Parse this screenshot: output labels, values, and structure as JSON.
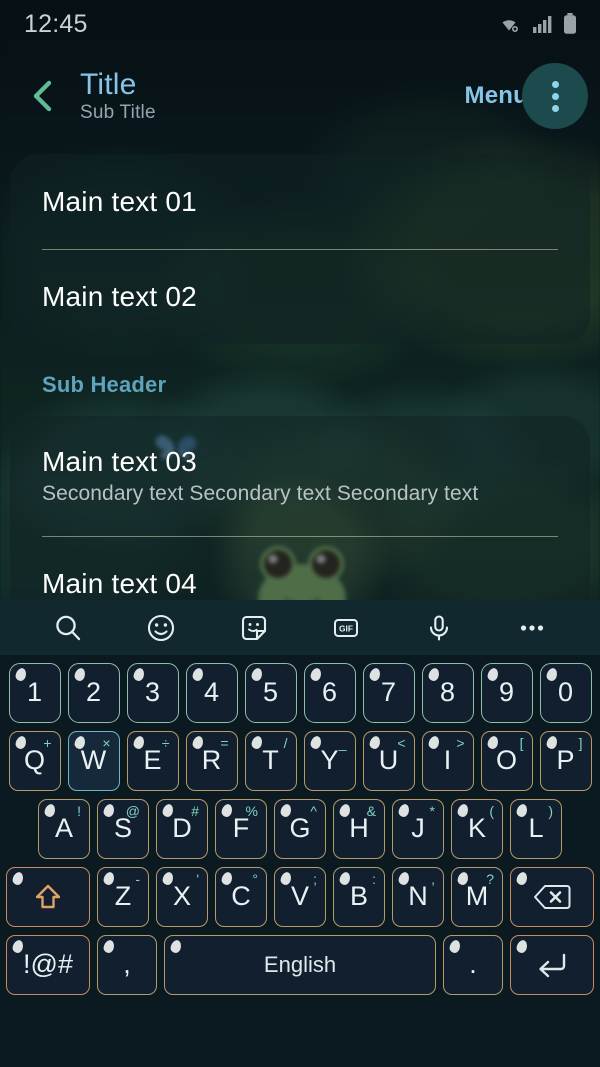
{
  "status_bar": {
    "clock": "12:45",
    "icons": [
      "wifi-icon",
      "signal-icon",
      "battery-icon"
    ]
  },
  "app_bar": {
    "back_icon": "chevron-left-icon",
    "title": "Title",
    "subtitle": "Sub Title",
    "menu_label": "Menu",
    "overflow_icon": "overflow-menu-icon",
    "colors": {
      "title": "#86c5e8",
      "subtitle": "#93a6ad",
      "back_arrow": "#5dbd96",
      "overflow_circle": "#1d4a4c"
    }
  },
  "content": {
    "sub_header": "Sub Header",
    "card1": {
      "items": [
        {
          "main": "Main text 01"
        },
        {
          "main": "Main text 02"
        }
      ]
    },
    "card2": {
      "items": [
        {
          "main": "Main text 03",
          "secondary": "Secondary text Secondary text Secondary text"
        },
        {
          "main": "Main text 04"
        }
      ]
    }
  },
  "keyboard": {
    "toolbar": [
      {
        "name": "search-icon",
        "label": "search"
      },
      {
        "name": "emoji-icon",
        "label": "emoji"
      },
      {
        "name": "sticker-icon",
        "label": "sticker"
      },
      {
        "name": "gif-icon",
        "label": "GIF"
      },
      {
        "name": "microphone-icon",
        "label": "voice input"
      },
      {
        "name": "more-options-icon",
        "label": "more"
      }
    ],
    "rows": {
      "numbers": [
        {
          "key": "1"
        },
        {
          "key": "2"
        },
        {
          "key": "3"
        },
        {
          "key": "4"
        },
        {
          "key": "5"
        },
        {
          "key": "6"
        },
        {
          "key": "7"
        },
        {
          "key": "8"
        },
        {
          "key": "9"
        },
        {
          "key": "0"
        }
      ],
      "top": [
        {
          "key": "Q",
          "sub": "+"
        },
        {
          "key": "W",
          "sub": "×",
          "active": true
        },
        {
          "key": "E",
          "sub": "÷"
        },
        {
          "key": "R",
          "sub": "="
        },
        {
          "key": "T",
          "sub": "/"
        },
        {
          "key": "Y",
          "sub": "_"
        },
        {
          "key": "U",
          "sub": "<"
        },
        {
          "key": "I",
          "sub": ">"
        },
        {
          "key": "O",
          "sub": "["
        },
        {
          "key": "P",
          "sub": "]"
        }
      ],
      "home": [
        {
          "key": "A",
          "sub": "!"
        },
        {
          "key": "S",
          "sub": "@"
        },
        {
          "key": "D",
          "sub": "#"
        },
        {
          "key": "F",
          "sub": "%"
        },
        {
          "key": "G",
          "sub": "^"
        },
        {
          "key": "H",
          "sub": "&"
        },
        {
          "key": "J",
          "sub": "*"
        },
        {
          "key": "K",
          "sub": "("
        },
        {
          "key": "L",
          "sub": ")"
        }
      ],
      "bottom": [
        {
          "key": "Z",
          "sub": "-"
        },
        {
          "key": "X",
          "sub": "'"
        },
        {
          "key": "C",
          "sub": "°"
        },
        {
          "key": "V",
          "sub": ";"
        },
        {
          "key": "B",
          "sub": ":"
        },
        {
          "key": "N",
          "sub": ","
        },
        {
          "key": "M",
          "sub": "?"
        }
      ]
    },
    "shift_label": "shift-icon",
    "backspace_label": "backspace-icon",
    "symbols_label": "!@#",
    "comma_label": ",",
    "space_label": "English",
    "period_label": ".",
    "enter_label": "enter-icon",
    "colors": {
      "key_fill": "#121f2e",
      "key_border": "#b59b6a",
      "number_border": "#8fbfa8",
      "function_border": "#c98a62",
      "active_border": "#6fb7bd",
      "toolbar_bg": "#10282e",
      "keyboard_bg": "#0b1a20"
    }
  }
}
